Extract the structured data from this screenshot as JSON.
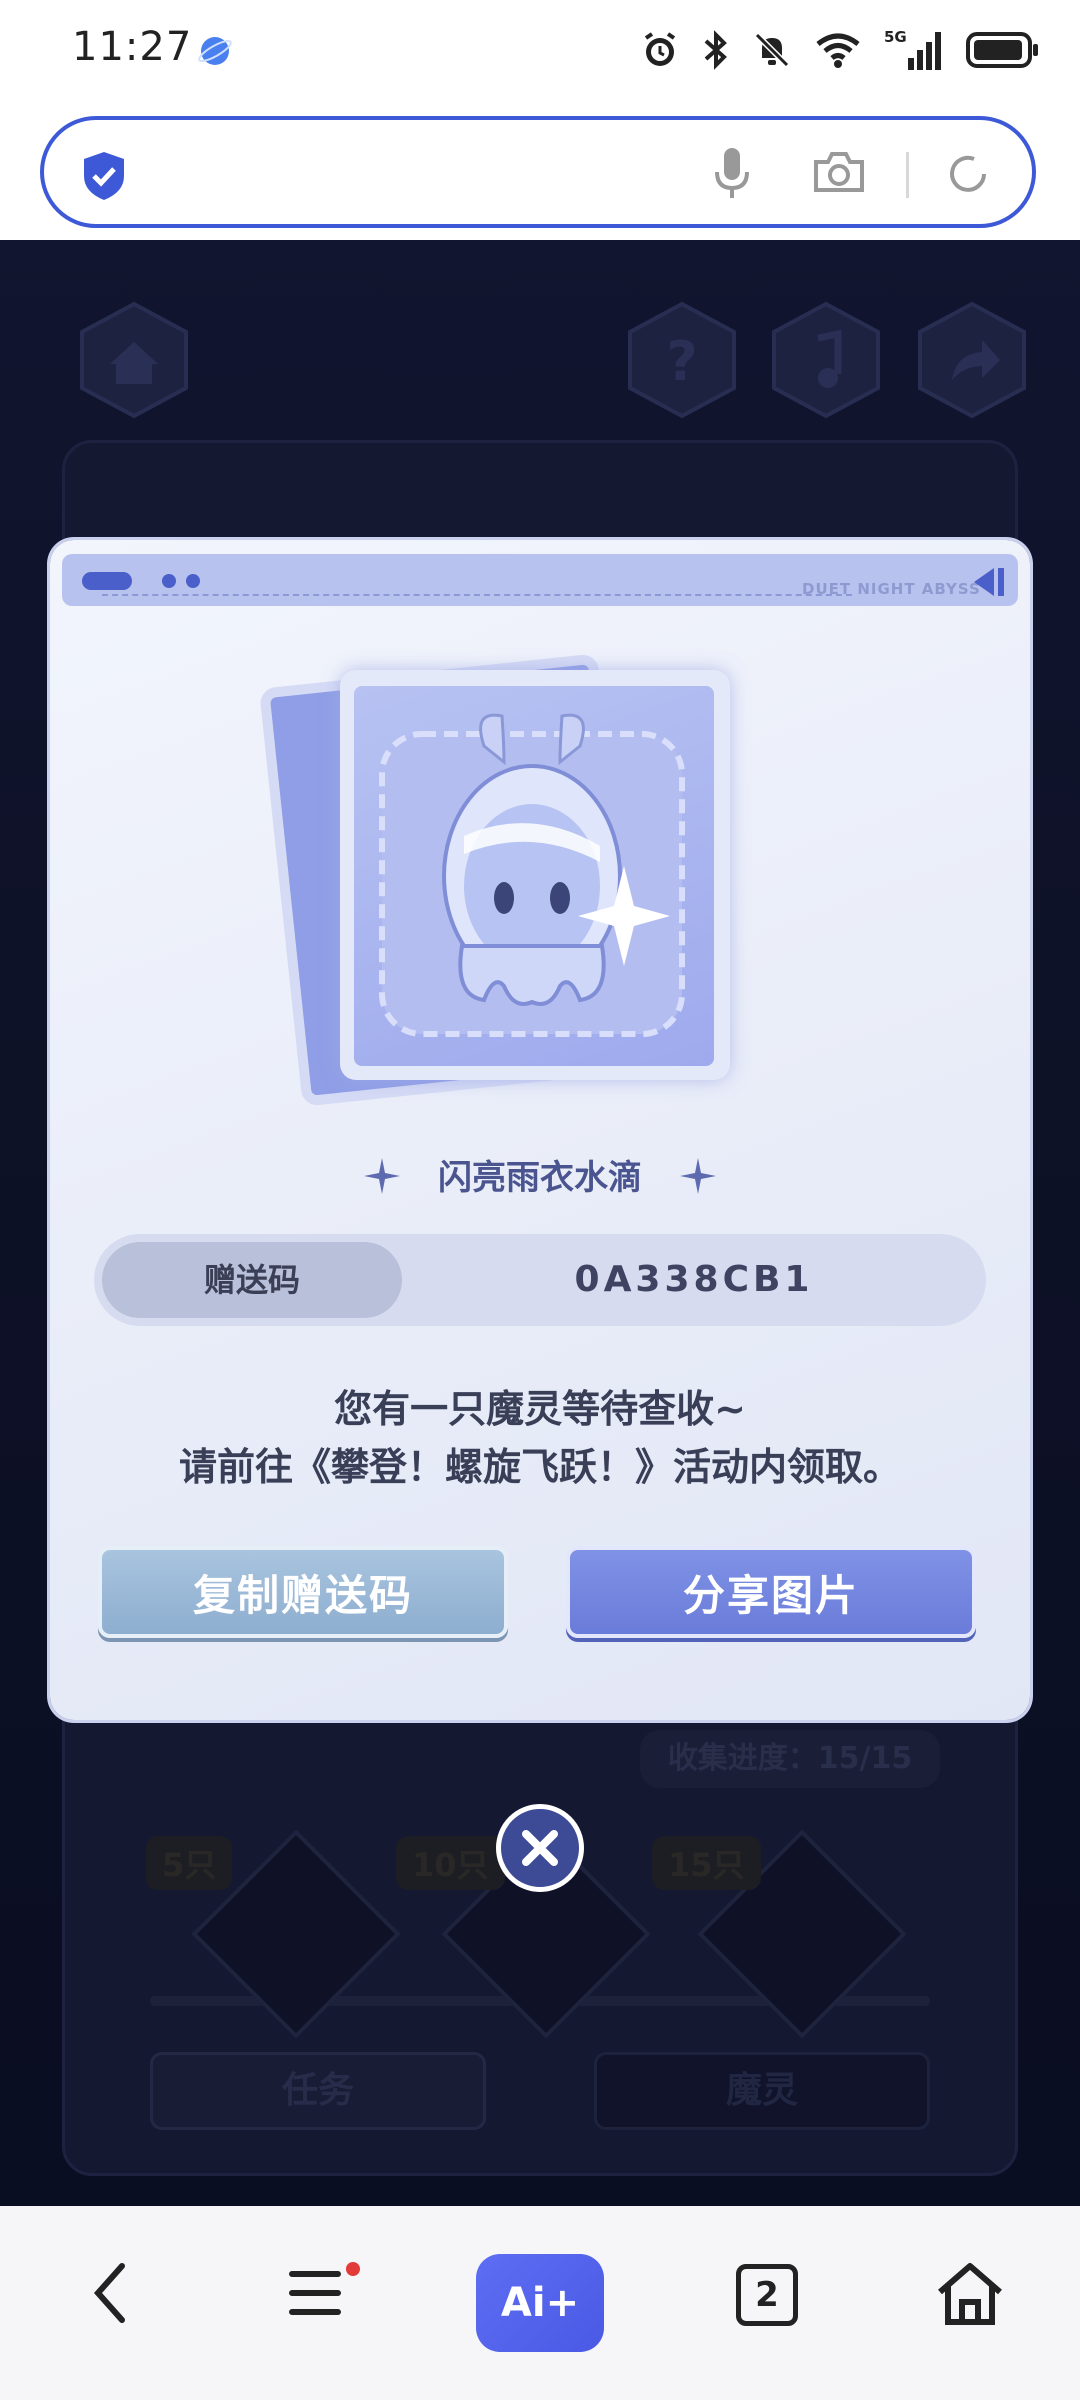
{
  "status_bar": {
    "time": "11:27",
    "icons": [
      "alarm-icon",
      "bluetooth-icon",
      "mute-icon",
      "wifi-icon",
      "5g-signal-icon",
      "battery-icon"
    ],
    "network_label": "5G"
  },
  "browser": {
    "url_value": "",
    "icons": [
      "shield-icon",
      "mic-icon",
      "camera-icon",
      "reload-icon"
    ],
    "accent": "#3d59d8"
  },
  "game_bg": {
    "collection_progress": "收集进度：15/15",
    "milestones": [
      "5只",
      "10只",
      "15只"
    ],
    "tabs": [
      "任务",
      "魔灵"
    ]
  },
  "modal": {
    "header_brand": "DUET NIGHT ABYSS",
    "item_name": "闪亮雨衣水滴",
    "code_label": "赠送码",
    "code_value": "0A338CB1",
    "message_line1": "您有一只魔灵等待查收~",
    "message_line2": "请前往《攀登！螺旋飞跃！》活动内领取。",
    "copy_button": "复制赠送码",
    "share_button": "分享图片"
  },
  "nav": {
    "ai_label": "Ai+",
    "tabs_count": "2",
    "icons": [
      "back-icon",
      "menu-icon",
      "ai-icon",
      "tabs-icon",
      "home-icon"
    ]
  },
  "colors": {
    "modal_bg": "#eef1fa",
    "copy_btn": "#9bb9d7",
    "share_btn": "#7486df",
    "close_btn": "#3d4a96"
  }
}
